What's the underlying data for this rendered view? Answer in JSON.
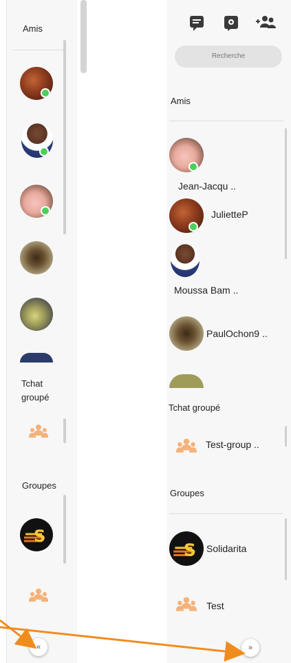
{
  "left_sidebar": {
    "friends_label": "Amis",
    "group_chat_label_line1": "Tchat",
    "group_chat_label_line2": "groupé",
    "groups_label": "Groupes",
    "expand_button_glyph": "«"
  },
  "right_sidebar": {
    "search_placeholder": "Recherche",
    "friends_label": "Amis",
    "friends": [
      {
        "name": "Jean-Jacqu ..",
        "online": true
      },
      {
        "name": "JulietteP",
        "online": true
      },
      {
        "name": "Moussa Bam ..",
        "online": false
      },
      {
        "name": "PaulOchon9 ..",
        "online": false
      }
    ],
    "group_chat_label": "Tchat groupé",
    "group_chats": [
      {
        "name": "Test-group .."
      }
    ],
    "groups_label": "Groupes",
    "groups": [
      {
        "name": "Solidarita"
      },
      {
        "name": "Test"
      }
    ],
    "collapse_button_glyph": "»",
    "top_icons": [
      "chat-icon",
      "settings-icon",
      "add-friend-icon"
    ]
  },
  "colors": {
    "online": "#4ccf5a",
    "annotation_arrow": "#f08c1e",
    "group_icon": "#f4b27a",
    "panel_bg": "#f7f7f7",
    "search_bg": "#e3e3e3"
  }
}
